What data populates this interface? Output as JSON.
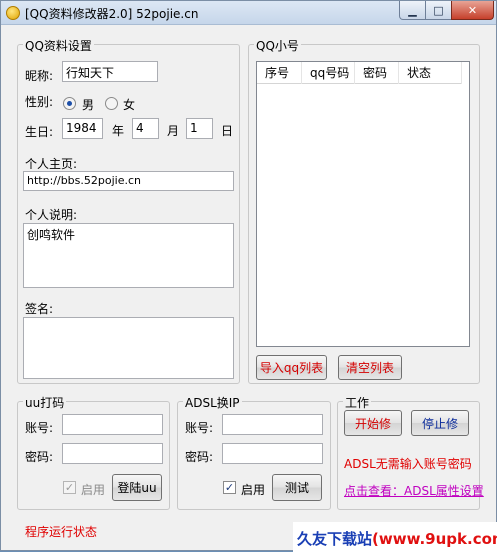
{
  "window": {
    "title": "[QQ资料修改器2.0]  52pojie.cn",
    "min_glyph": "▁",
    "max_glyph": "□",
    "close_glyph": "✕"
  },
  "profile": {
    "group_title": "QQ资料设置",
    "nickname_label": "昵称:",
    "nickname_value": "行知天下",
    "gender_label": "性别:",
    "gender_male": "男",
    "gender_female": "女",
    "gender_selected": "男",
    "birthday_label": "生日:",
    "birth_year": "1984",
    "year_unit": "年",
    "birth_month": "4",
    "month_unit": "月",
    "birth_day": "1",
    "day_unit": "日",
    "homepage_label": "个人主页:",
    "homepage_value": "http://bbs.52pojie.cn",
    "description_label": "个人说明:",
    "description_value": "创鸣软件",
    "signature_label": "签名:",
    "signature_value": ""
  },
  "qq_list": {
    "group_title": "QQ小号",
    "columns": [
      "序号",
      "qq号码",
      "密码",
      "状态"
    ],
    "rows": [],
    "import_button": "导入qq列表",
    "clear_button": "清空列表"
  },
  "uu": {
    "group_title": "uu打码",
    "account_label": "账号:",
    "account_value": "",
    "password_label": "密码:",
    "password_value": "",
    "enable_label": "启用",
    "enable_checked": true,
    "login_button": "登陆uu"
  },
  "adsl": {
    "group_title": "ADSL换IP",
    "account_label": "账号:",
    "account_value": "",
    "password_label": "密码:",
    "password_value": "",
    "enable_label": "启用",
    "enable_checked": true,
    "test_button": "测试"
  },
  "work": {
    "group_title": "工作",
    "start_button": "开始修",
    "stop_button": "停止修",
    "note_text": "ADSL无需输入账号密码",
    "link_text": "点击查看：ADSL属性设置"
  },
  "status": {
    "text": "程序运行状态"
  },
  "watermark": {
    "part1": "久友下载站",
    "part2": "(www.9upk.com)"
  },
  "colors": {
    "accent_red": "#e00000",
    "link_magenta": "#c000c0",
    "radio_dot": "#1d4fa8"
  }
}
